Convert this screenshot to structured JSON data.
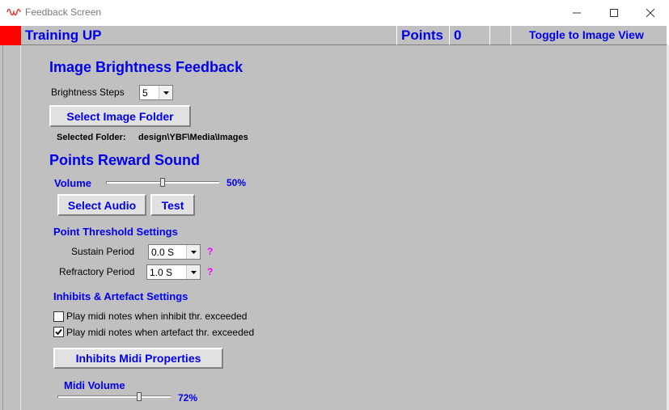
{
  "window": {
    "title": "Feedback Screen"
  },
  "header": {
    "mode": "Training UP",
    "points_label": "Points",
    "points_value": "0",
    "toggle_label": "Toggle to Image View"
  },
  "image_brightness": {
    "heading": "Image Brightness Feedback",
    "steps_label": "Brightness Steps",
    "steps_value": "5",
    "select_folder_label": "Select Image Folder",
    "selected_folder_label": "Selected Folder:",
    "selected_folder_value": "design\\YBF\\Media\\Images"
  },
  "reward_sound": {
    "heading": "Points Reward Sound",
    "volume_label": "Volume",
    "volume_value": 50,
    "volume_text": "50%",
    "select_audio_label": "Select Audio",
    "test_label": "Test"
  },
  "threshold": {
    "heading": "Point Threshold Settings",
    "sustain_label": "Sustain Period",
    "sustain_value": "0.0 S",
    "refractory_label": "Refractory Period",
    "refractory_value": "1.0 S",
    "help_glyph": "?"
  },
  "inhibits": {
    "heading": "Inhibits & Artefact Settings",
    "checkbox_inhibit_label": "Play midi notes when inhibit thr. exceeded",
    "checkbox_inhibit_checked": false,
    "checkbox_artefact_label": "Play midi notes when artefact thr. exceeded",
    "checkbox_artefact_checked": true,
    "midi_properties_label": "Inhibits Midi Properties",
    "midi_volume_label": "Midi Volume",
    "midi_volume_value": 72,
    "midi_volume_text": "72%"
  },
  "colors": {
    "accent_blue": "#0000ee",
    "panel_gray": "#c0c0c0",
    "status_red": "#ff0000",
    "help_magenta": "#ff00ff"
  }
}
